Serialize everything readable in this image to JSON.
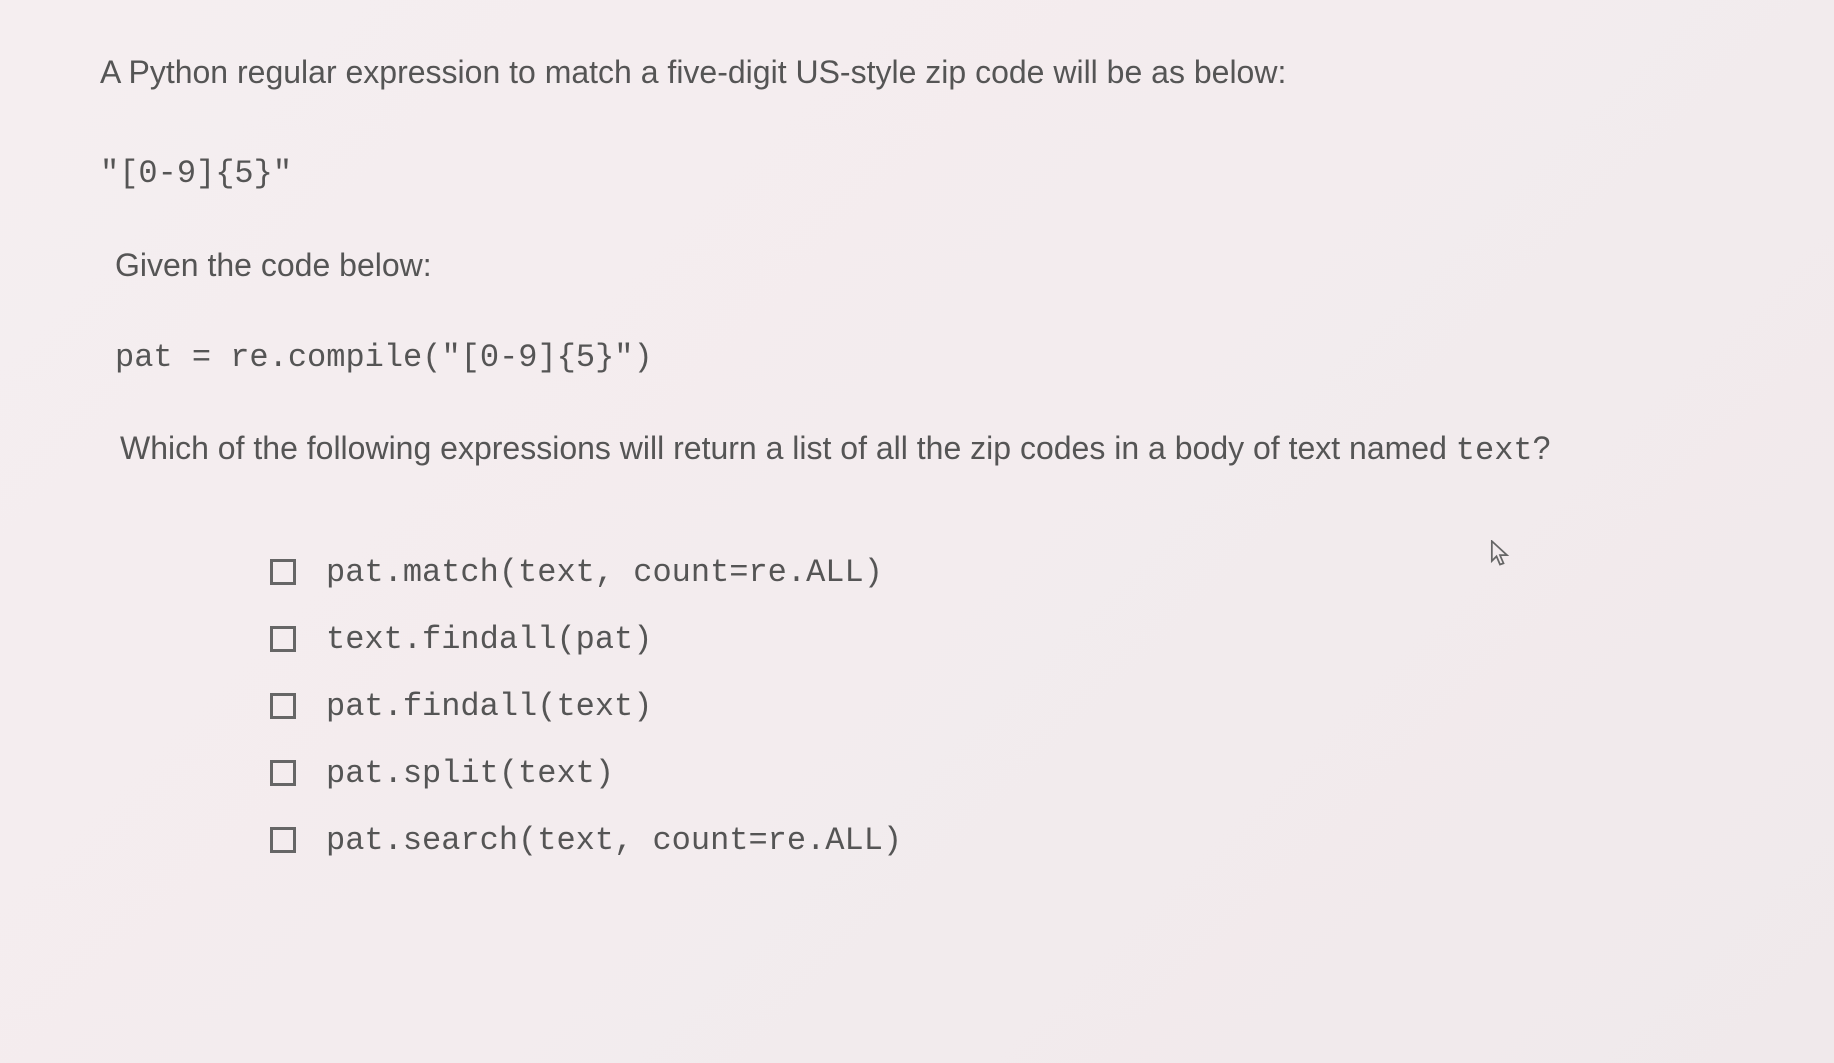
{
  "question": {
    "intro": "A Python regular expression to match a five-digit US-style zip code will be as below:",
    "pattern": "\"[0-9]{5}\"",
    "given": "Given the code below:",
    "code": "pat = re.compile(\"[0-9]{5}\")",
    "prompt_prefix": "Which of the following expressions will return a list of all the zip codes in a body of text named ",
    "prompt_code": "text",
    "prompt_suffix": "?"
  },
  "options": [
    {
      "label": "pat.match(text, count=re.ALL)",
      "checked": false
    },
    {
      "label": "text.findall(pat)",
      "checked": false
    },
    {
      "label": "pat.findall(text)",
      "checked": false
    },
    {
      "label": "pat.split(text)",
      "checked": false
    },
    {
      "label": "pat.search(text, count=re.ALL)",
      "checked": false
    }
  ]
}
